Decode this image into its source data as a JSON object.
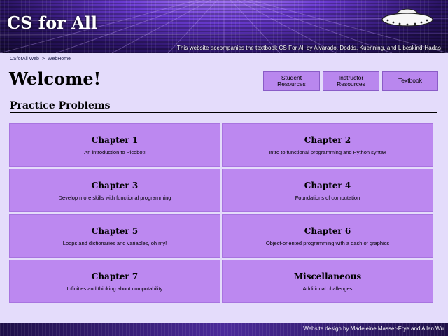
{
  "site": {
    "title": "CS for All",
    "tagline": "This website accompanies the textbook CS For All by Alvarado, Dodds, Kuenning, and Libeskind-Hadas"
  },
  "breadcrumb": {
    "root": "CSforAll Web",
    "separator": ">",
    "current": "WebHome"
  },
  "page": {
    "heading": "Welcome!",
    "section_title": "Practice Problems"
  },
  "nav_buttons": [
    {
      "line1": "Student",
      "line2": "Resources"
    },
    {
      "line1": "Instructor",
      "line2": "Resources"
    },
    {
      "line1": "Textbook",
      "line2": ""
    }
  ],
  "cards": [
    {
      "title": "Chapter 1",
      "desc": "An introduction to Picobot!"
    },
    {
      "title": "Chapter 2",
      "desc": "Intro to functional programming and Python syntax"
    },
    {
      "title": "Chapter 3",
      "desc": "Develop more skills with functional programming"
    },
    {
      "title": "Chapter 4",
      "desc": "Foundations of computation"
    },
    {
      "title": "Chapter 5",
      "desc": "Loops and dictionaries and variables, oh my!"
    },
    {
      "title": "Chapter 6",
      "desc": "Object-oriented programming with a dash of graphics"
    },
    {
      "title": "Chapter 7",
      "desc": "Infinities and thinking about computability"
    },
    {
      "title": "Miscellaneous",
      "desc": "Additional challenges"
    }
  ],
  "footer": {
    "credit": "Website design by Madeleine Masser-Frye and Allen Wu"
  },
  "colors": {
    "page_background": "#e4dcfb",
    "card": "#bc88f0",
    "button": "#b987ee",
    "banner": "#2b1466"
  },
  "icons": {
    "banner_graphic": "flying-saucer-icon"
  }
}
